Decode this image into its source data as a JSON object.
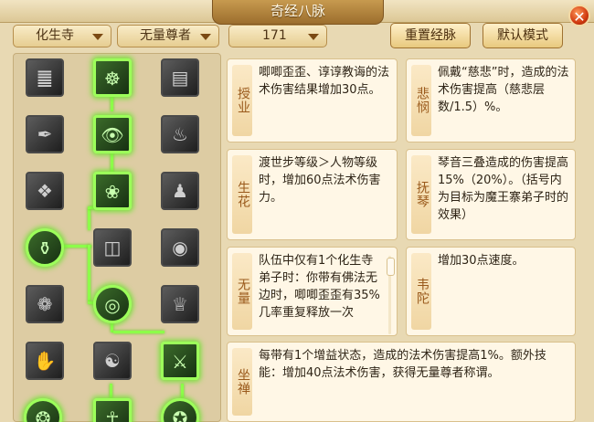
{
  "window": {
    "title": "奇经八脉",
    "close_label": "✕"
  },
  "filters": {
    "school": "化生寺",
    "skill": "无量尊者",
    "level": "171"
  },
  "buttons": {
    "reset": "重置经脉",
    "default": "默认模式"
  },
  "icons": [
    {
      "name": "scroll-icon",
      "glyph": "䷀",
      "active": false
    },
    {
      "name": "meditation-icon",
      "glyph": "☸",
      "active": true
    },
    {
      "name": "tablet-icon",
      "glyph": "▤",
      "active": false
    },
    {
      "name": "ink-icon",
      "glyph": "✒",
      "active": false
    },
    {
      "name": "eye-icon",
      "glyph": "👁",
      "active": true
    },
    {
      "name": "flame-spirit-icon",
      "glyph": "♨",
      "active": false
    },
    {
      "name": "fan-icon",
      "glyph": "❖",
      "active": false
    },
    {
      "name": "flower-icon",
      "glyph": "❀",
      "active": true
    },
    {
      "name": "monk-icon",
      "glyph": "♟",
      "active": false
    },
    {
      "name": "gourd-icon",
      "glyph": "⚱",
      "active": true
    },
    {
      "name": "bowl-icon",
      "glyph": "◫",
      "active": false
    },
    {
      "name": "alms-bowl-icon",
      "glyph": "◉",
      "active": false
    },
    {
      "name": "lotus-icon",
      "glyph": "❁",
      "active": false
    },
    {
      "name": "halo-icon",
      "glyph": "◎",
      "active": true
    },
    {
      "name": "bell-icon",
      "glyph": "♕",
      "active": false
    },
    {
      "name": "hand-icon",
      "glyph": "✋",
      "active": false
    },
    {
      "name": "seated-monk-icon",
      "glyph": "☯",
      "active": false
    },
    {
      "name": "sword-wind-icon",
      "glyph": "⚔",
      "active": true
    },
    {
      "name": "rune-circle-icon",
      "glyph": "❂",
      "active": true
    },
    {
      "name": "buddha-icon",
      "glyph": "☥",
      "active": true
    },
    {
      "name": "seal-circle-icon",
      "glyph": "✪",
      "active": true
    }
  ],
  "cards": [
    {
      "tag": "授业",
      "text": "唧唧歪歪、谆谆教诲的法术伤害结果增加30点。"
    },
    {
      "tag": "悲悯",
      "text": "佩戴“慈悲”时，造成的法术伤害提高（慈悲层数/1.5）%。"
    },
    {
      "tag": "生花",
      "text": "渡世步等级＞人物等级时，增加60点法术伤害力。"
    },
    {
      "tag": "抚琴",
      "text": "琴音三叠造成的伤害提高15%（20%）。（括号内为目标为魔王寨弟子时的效果）"
    },
    {
      "tag": "无量",
      "text": "队伍中仅有1个化生寺弟子时：你带有佛法无边时，唧唧歪歪有35%几率重复释放一次"
    },
    {
      "tag": "韦陀",
      "text": "增加30点速度。"
    },
    {
      "tag": "坐禅",
      "text": "每带有1个增益状态，造成的法术伤害提高1%。额外技能：增加40点法术伤害，获得无量尊者称谓。"
    }
  ]
}
